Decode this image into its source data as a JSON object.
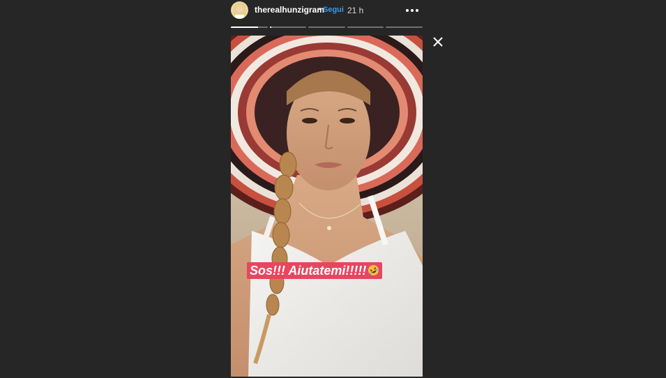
{
  "header": {
    "avatar_icon": "profile-avatar",
    "username": "therealhunzigram",
    "separator": "•",
    "follow_label": "Segui",
    "time_ago": "21 h",
    "more_icon": "more-options-icon"
  },
  "progress": {
    "segments": [
      0.75,
      0.05,
      0,
      0,
      0
    ]
  },
  "story": {
    "caption": "Sos!!! Aiutatemi!!!!!",
    "caption_emoji": "rolling-on-floor-laughing-icon",
    "caption_bg": "#e8455f",
    "photo_description_icon": "story-photo"
  },
  "close_icon": "close-icon",
  "colors": {
    "background": "#262626",
    "link": "#3897f0"
  }
}
